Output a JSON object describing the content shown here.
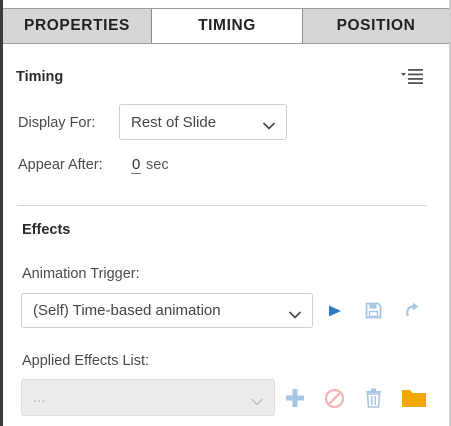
{
  "tabs": [
    {
      "label": "PROPERTIES",
      "active": false
    },
    {
      "label": "TIMING",
      "active": true
    },
    {
      "label": "POSITION",
      "active": false
    }
  ],
  "timing": {
    "title": "Timing",
    "display_for_label": "Display For:",
    "display_for_value": "Rest of Slide",
    "appear_after_label": "Appear After:",
    "appear_after_value": "0",
    "appear_after_unit": "sec"
  },
  "effects": {
    "title": "Effects",
    "trigger_label": "Animation Trigger:",
    "trigger_value": "(Self) Time-based animation",
    "applied_label": "Applied Effects List:",
    "applied_value": "..."
  },
  "icons": {
    "panel_menu": "panel-menu-icon",
    "play": "play-icon",
    "save": "save-icon",
    "redo": "redo-icon",
    "add": "add-icon",
    "disable": "disable-icon",
    "trash": "trash-icon",
    "folder": "folder-icon"
  },
  "colors": {
    "accent_blue": "#2c7dc8",
    "light_blue": "#a7c6e4",
    "disabled_red": "#f3b8b8",
    "folder": "#f1a800",
    "tab_inactive": "#d6d6d6"
  }
}
